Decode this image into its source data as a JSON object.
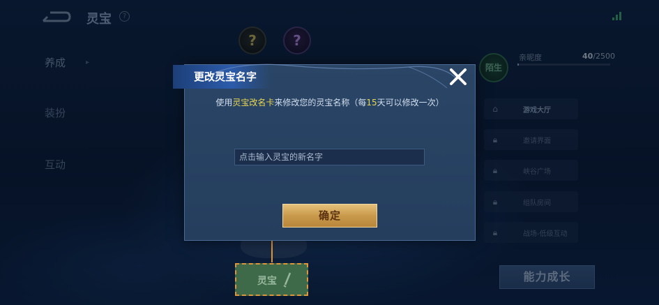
{
  "header": {
    "title": "灵宝",
    "help_symbol": "?"
  },
  "sidebar": {
    "items": [
      {
        "label": "养成"
      },
      {
        "label": "装扮"
      },
      {
        "label": "互动"
      }
    ]
  },
  "badges": {
    "symbol": "?"
  },
  "relationship": {
    "status_badge": "陌生",
    "intimacy_label": "亲昵度",
    "intimacy_current": "40",
    "intimacy_total": "/2500",
    "intimacy_fraction": 0.016
  },
  "right_menu": {
    "items": [
      {
        "label": "游戏大厅",
        "icon": "home-icon"
      },
      {
        "label": "邀请界面",
        "icon": "lock-icon"
      },
      {
        "label": "峡谷广场",
        "icon": "lock-icon"
      },
      {
        "label": "组队房间",
        "icon": "lock-icon"
      },
      {
        "label": "战场-低级互动",
        "icon": "lock-icon"
      }
    ],
    "grow_button": "能力成长"
  },
  "bottom_tab": {
    "label": "灵宝"
  },
  "dialog": {
    "title": "更改灵宝名字",
    "desc_prefix": "使用",
    "desc_item": "灵宝改名卡",
    "desc_middle": "来修改您的灵宝名称（每",
    "desc_days": "15",
    "desc_suffix": "天可以修改一次）",
    "input_value": "",
    "input_placeholder": "点击输入灵宝的新名字",
    "confirm_label": "确定"
  },
  "colors": {
    "highlight": "#e9d750",
    "annotation": "#e0953a",
    "confirm_gold": "#c99a4c"
  }
}
